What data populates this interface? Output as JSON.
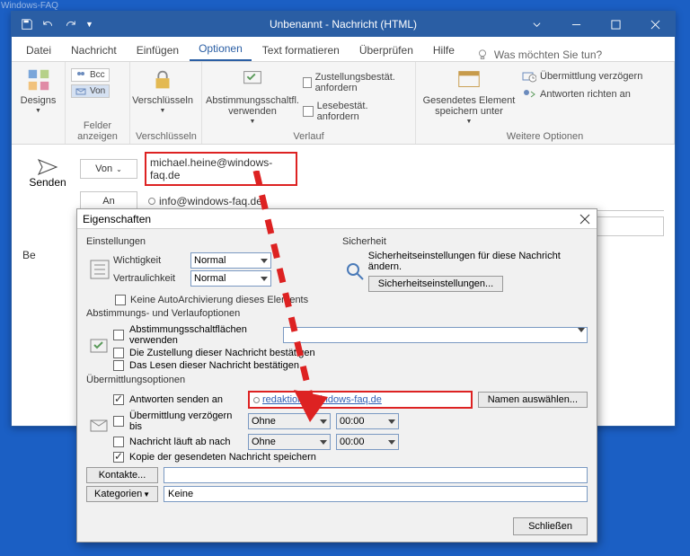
{
  "watermark": "Windows-FAQ",
  "window": {
    "title": "Unbenannt - Nachricht (HTML)",
    "tabs": [
      "Datei",
      "Nachricht",
      "Einfügen",
      "Optionen",
      "Text formatieren",
      "Überprüfen",
      "Hilfe"
    ],
    "active_tab": "Optionen",
    "tellme": "Was möchten Sie tun?"
  },
  "ribbon": {
    "designs": "Designs",
    "bcc": "Bcc",
    "von": "Von",
    "groups": {
      "felder": "Felder anzeigen",
      "verschl_caption": "Verschlüsseln",
      "verschl_btn": "Verschlüsseln",
      "verlauf": "Verlauf",
      "abstimmung": "Abstimmungsschaltfl. verwenden",
      "zustell": "Zustellungsbestät. anfordern",
      "lese": "Lesebestät. anfordern",
      "weitere": "Weitere Optionen",
      "gesendetes": "Gesendetes Element speichern unter",
      "ueberm": "Übermittlung verzögern",
      "antw": "Antworten richten an"
    }
  },
  "compose": {
    "send": "Senden",
    "von_btn": "Von",
    "an_btn": "An",
    "from_value": "michael.heine@windows-faq.de",
    "to_value": "info@windows-faq.de;",
    "body_prefix": "Be"
  },
  "props": {
    "title": "Eigenschaften",
    "sections": {
      "einstellungen": "Einstellungen",
      "sicherheit": "Sicherheit",
      "abstimmung": "Abstimmungs- und Verlaufoptionen",
      "ueberm": "Übermittlungsoptionen"
    },
    "fields": {
      "wichtigkeit": "Wichtigkeit",
      "wichtigkeit_val": "Normal",
      "vertraulichkeit": "Vertraulichkeit",
      "vertraulichkeit_val": "Normal",
      "keine_auto": "Keine AutoArchivierung dieses Elements",
      "sich_text": "Sicherheitseinstellungen für diese Nachricht ändern.",
      "sich_btn": "Sicherheitseinstellungen...",
      "abstimmung_chk": "Abstimmungsschaltflächen verwenden",
      "zustell_chk": "Die Zustellung dieser Nachricht bestätigen",
      "lesen_chk": "Das Lesen dieser Nachricht bestätigen",
      "antworten_an": "Antworten senden an",
      "antworten_val": "redaktion@windows-faq.de",
      "namen": "Namen auswählen...",
      "ueberm_ver": "Übermittlung verzögern bis",
      "ablauf": "Nachricht läuft ab nach",
      "ohne": "Ohne",
      "zeit": "00:00",
      "kopie": "Kopie der gesendeten Nachricht speichern",
      "kontakte": "Kontakte...",
      "kategorien": "Kategorien",
      "kategorien_val": "Keine",
      "schliessen": "Schließen"
    }
  }
}
